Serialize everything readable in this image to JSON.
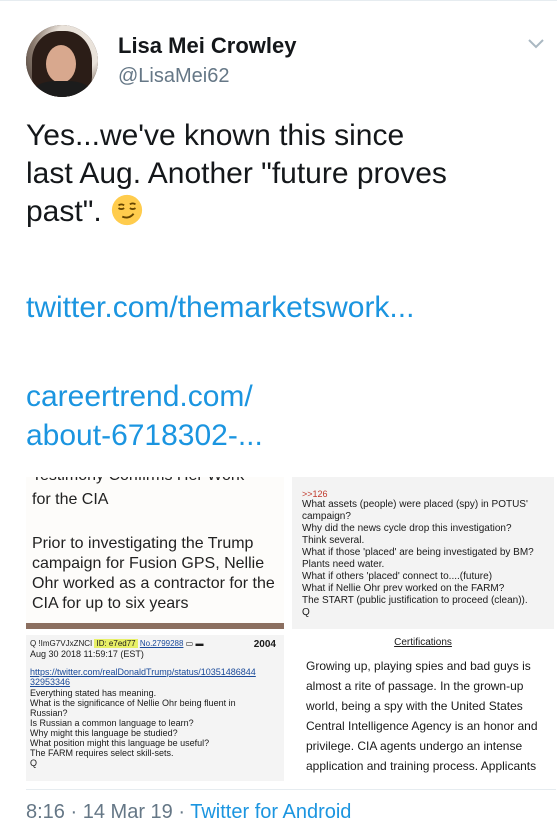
{
  "tweet": {
    "author": {
      "display_name": "Lisa Mei Crowley",
      "handle": "@LisaMei62"
    },
    "text_lines": [
      "Yes...we've known this since",
      "last Aug. Another \"future proves",
      "past\"."
    ],
    "emoji": "smirking-face",
    "links": [
      "twitter.com/themarketswork...",
      "careertrend.com/",
      "about-6718302-..."
    ],
    "time": "8:16",
    "date": "14 Mar 19",
    "source": "Twitter for Android",
    "separator": "·"
  },
  "media": {
    "panel1": {
      "cut_line": "Testimony Confirms Her Work",
      "lines": [
        "for the CIA",
        "Prior to investigating the Trump",
        "campaign for Fusion GPS, Nellie",
        "Ohr worked as a contractor for the",
        "CIA for up to six years"
      ]
    },
    "panel2": {
      "ref": ">>126",
      "lines": [
        "What assets (people) were placed (spy) in POTUS'",
        "campaign?",
        "Why did the news cycle drop this investigation?",
        "Think several.",
        "What if those 'placed' are being investigated by BM?",
        "Plants need water.",
        "What if others 'placed' connect to....(future)",
        "What if Nellie Ohr prev worked on the FARM?",
        "The START (public justification to proceed (clean)).",
        "Q"
      ]
    },
    "panel3": {
      "trip": "Q !ImG7VJxZNCI",
      "id_label": "ID: e7ed77",
      "post_no": "No.2799288",
      "count": "2004",
      "date": "Aug 30 2018 11:59:17 (EST)",
      "url_lines": [
        "https://twitter.com/realDonaldTrump/status/10351486844",
        "32953346"
      ],
      "lines": [
        "Everything stated has meaning.",
        "What is the significance of Nellie Ohr being fluent in",
        "Russian?",
        "Is Russian a common language to learn?",
        "Why might this language be studied?",
        "What position might this language be useful?",
        "The FARM requires select skill-sets.",
        "Q"
      ]
    },
    "panel4": {
      "heading": "Certifications",
      "lines": [
        "Growing up, playing spies and bad guys is",
        "almost a rite of passage. In the grown-up",
        "world, being a spy with the United States",
        "Central Intelligence Agency is an honor and",
        "privilege. CIA agents undergo an intense",
        "application and training process. Applicants"
      ]
    }
  }
}
